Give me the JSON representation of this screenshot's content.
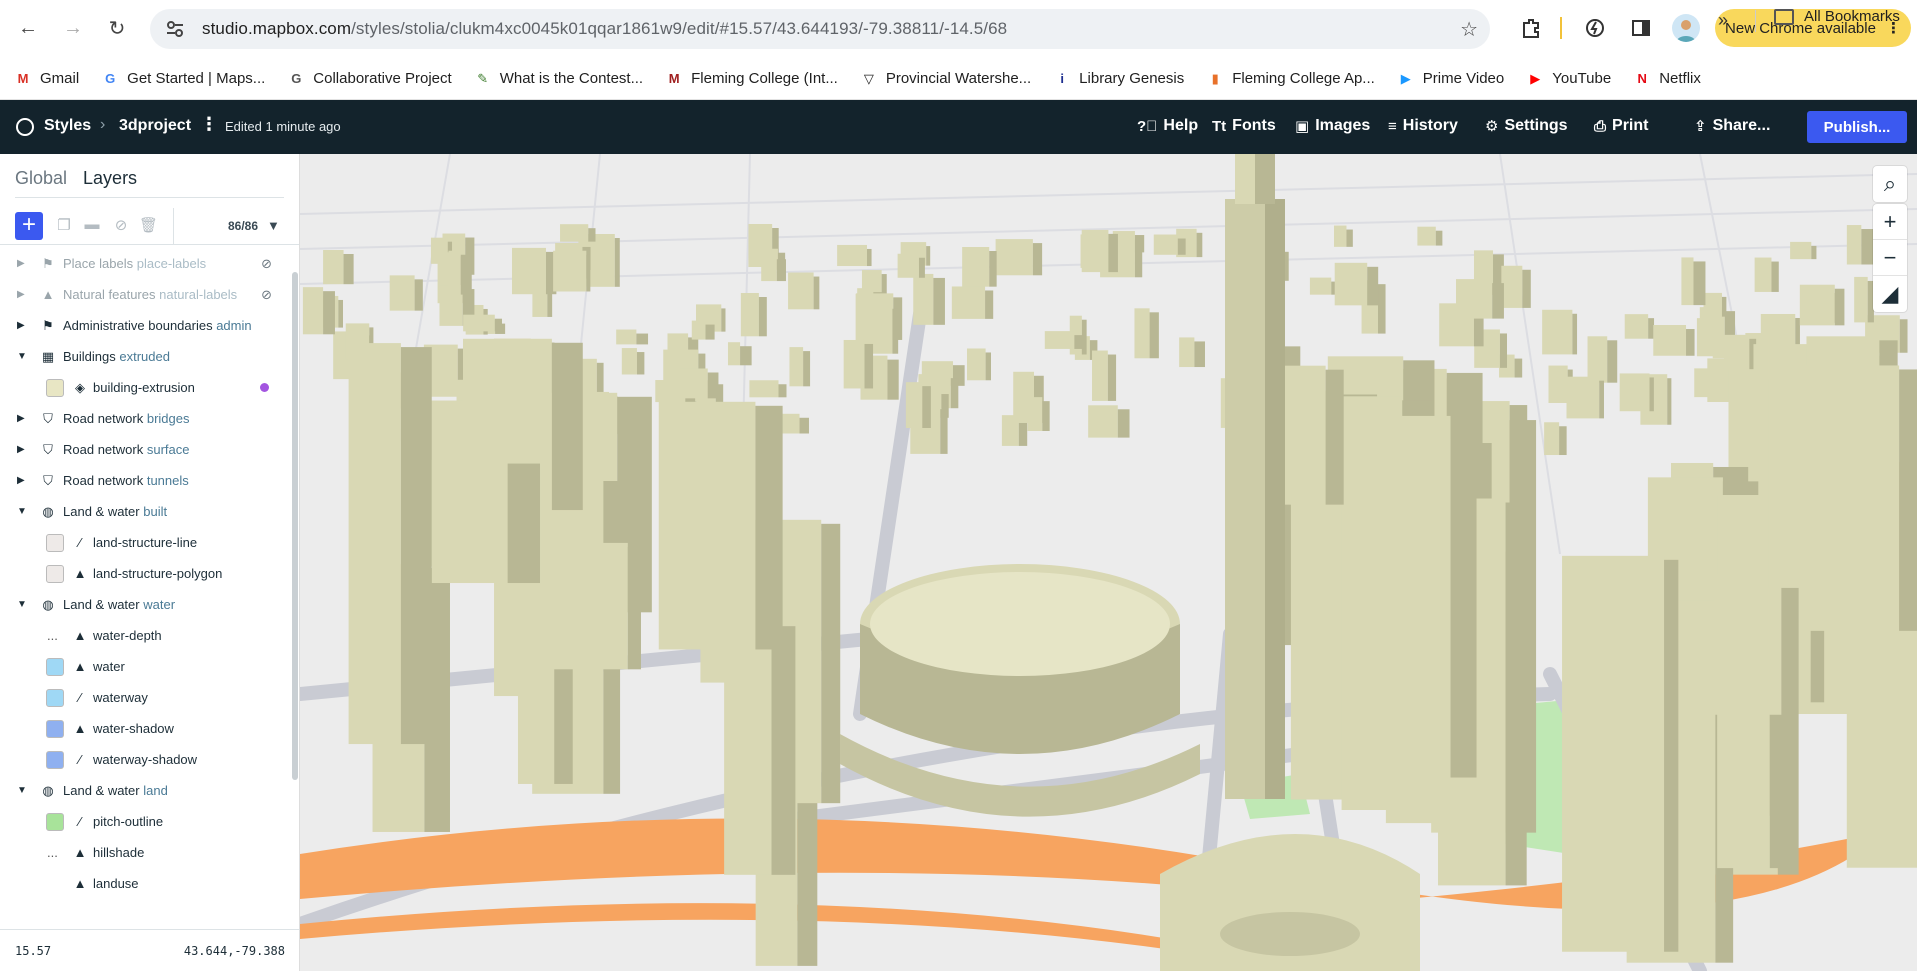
{
  "browser": {
    "url_host": "studio.mapbox.com",
    "url_path": "/styles/stolia/clukm4xc0045k01qqar1861w9/edit/#15.57/43.644193/-79.38811/-14.5/68",
    "update_label": "New Chrome available"
  },
  "bookmarks": [
    {
      "label": "Gmail",
      "icon": "gmail-icon",
      "color": "#d93025",
      "glyph": "M"
    },
    {
      "label": "Get Started | Maps...",
      "icon": "google-icon",
      "color": "#4285f4",
      "glyph": "G"
    },
    {
      "label": "Collaborative Project",
      "icon": "gis-icon",
      "color": "#555555",
      "glyph": "G"
    },
    {
      "label": "What is the Contest...",
      "icon": "contest-icon",
      "color": "#3a7a2a",
      "glyph": "✎"
    },
    {
      "label": "Fleming College (Int...",
      "icon": "medium-icon",
      "color": "#a02020",
      "glyph": "M"
    },
    {
      "label": "Provincial Watershe...",
      "icon": "shield-icon",
      "color": "#222222",
      "glyph": "▽"
    },
    {
      "label": "Library Genesis",
      "icon": "library-icon",
      "color": "#1d2e8f",
      "glyph": "i"
    },
    {
      "label": "Fleming College Ap...",
      "icon": "chart-icon",
      "color": "#e8712a",
      "glyph": "▮"
    },
    {
      "label": "Prime Video",
      "icon": "prime-icon",
      "color": "#1a98ff",
      "glyph": "▶"
    },
    {
      "label": "YouTube",
      "icon": "youtube-icon",
      "color": "#ff0000",
      "glyph": "▶"
    },
    {
      "label": "Netflix",
      "icon": "netflix-icon",
      "color": "#e50914",
      "glyph": "N"
    }
  ],
  "bookmarks_all": "All Bookmarks",
  "header": {
    "styles": "Styles",
    "project": "3dproject",
    "edited": "Edited 1 minute ago",
    "help": "Help",
    "fonts": "Fonts",
    "images": "Images",
    "history": "History",
    "settings": "Settings",
    "print": "Print",
    "share": "Share...",
    "publish": "Publish..."
  },
  "panel": {
    "tab_global": "Global",
    "tab_layers": "Layers",
    "count": "86/86",
    "rows": [
      {
        "kind": "group",
        "name": "Place labels",
        "sub": "place-labels",
        "icon": "label-icon",
        "glyph": "⚑",
        "dim": true,
        "hidden": true,
        "open": false
      },
      {
        "kind": "group",
        "name": "Natural features",
        "sub": "natural-labels",
        "icon": "mountain-icon",
        "glyph": "▲",
        "dim": true,
        "hidden": true,
        "open": false
      },
      {
        "kind": "group",
        "name": "Administrative boundaries",
        "sub": "admin",
        "icon": "flag-icon",
        "glyph": "⚑",
        "open": false
      },
      {
        "kind": "group",
        "name": "Buildings",
        "sub": "extruded",
        "icon": "building-icon",
        "glyph": "▦",
        "open": true
      },
      {
        "kind": "layer",
        "name": "building-extrusion",
        "icon": "extrusion-icon",
        "glyph": "◈",
        "swatch": "#e8e6c4",
        "dot": true
      },
      {
        "kind": "group",
        "name": "Road network",
        "sub": "bridges",
        "icon": "road-icon",
        "glyph": "⛉",
        "open": false
      },
      {
        "kind": "group",
        "name": "Road network",
        "sub": "surface",
        "icon": "road-icon",
        "glyph": "⛉",
        "open": false
      },
      {
        "kind": "group",
        "name": "Road network",
        "sub": "tunnels",
        "icon": "road-icon",
        "glyph": "⛉",
        "open": false
      },
      {
        "kind": "group",
        "name": "Land & water",
        "sub": "built",
        "icon": "globe-icon",
        "glyph": "◍",
        "open": true
      },
      {
        "kind": "layer",
        "name": "land-structure-line",
        "icon": "line-icon",
        "glyph": "∕",
        "swatch": "#eeeae8"
      },
      {
        "kind": "layer",
        "name": "land-structure-polygon",
        "icon": "fill-icon",
        "glyph": "▲",
        "swatch": "#eeeae8"
      },
      {
        "kind": "group",
        "name": "Land & water",
        "sub": "water",
        "icon": "globe-icon",
        "glyph": "◍",
        "open": true
      },
      {
        "kind": "layer",
        "name": "water-depth",
        "icon": "fill-icon",
        "glyph": "▲",
        "ellipsis": "..."
      },
      {
        "kind": "layer",
        "name": "water",
        "icon": "fill-icon",
        "glyph": "▲",
        "swatch": "#9fd8f5"
      },
      {
        "kind": "layer",
        "name": "waterway",
        "icon": "line-icon",
        "glyph": "∕",
        "swatch": "#9fd8f5"
      },
      {
        "kind": "layer",
        "name": "water-shadow",
        "icon": "fill-icon",
        "glyph": "▲",
        "swatch": "#8fb0f0"
      },
      {
        "kind": "layer",
        "name": "waterway-shadow",
        "icon": "line-icon",
        "glyph": "∕",
        "swatch": "#8fb0f0"
      },
      {
        "kind": "group",
        "name": "Land & water",
        "sub": "land",
        "icon": "globe-icon",
        "glyph": "◍",
        "open": true
      },
      {
        "kind": "layer",
        "name": "pitch-outline",
        "icon": "line-icon",
        "glyph": "∕",
        "swatch": "#a8e39a"
      },
      {
        "kind": "layer",
        "name": "hillshade",
        "icon": "fill-icon",
        "glyph": "▲",
        "ellipsis": "..."
      },
      {
        "kind": "layer",
        "name": "landuse",
        "icon": "fill-icon",
        "glyph": "▲"
      }
    ],
    "zoom": "15.57",
    "coords": "43.644,-79.388"
  },
  "map": {
    "zoom_in": "+",
    "zoom_out": "−",
    "colors": {
      "building": "#d9d8b4",
      "building_side": "#b8b794",
      "building_dark": "#a7a680",
      "ground": "#ececec",
      "road": "#c9cbd3",
      "park": "#bfe8b4",
      "highway": "#f7a460"
    }
  }
}
